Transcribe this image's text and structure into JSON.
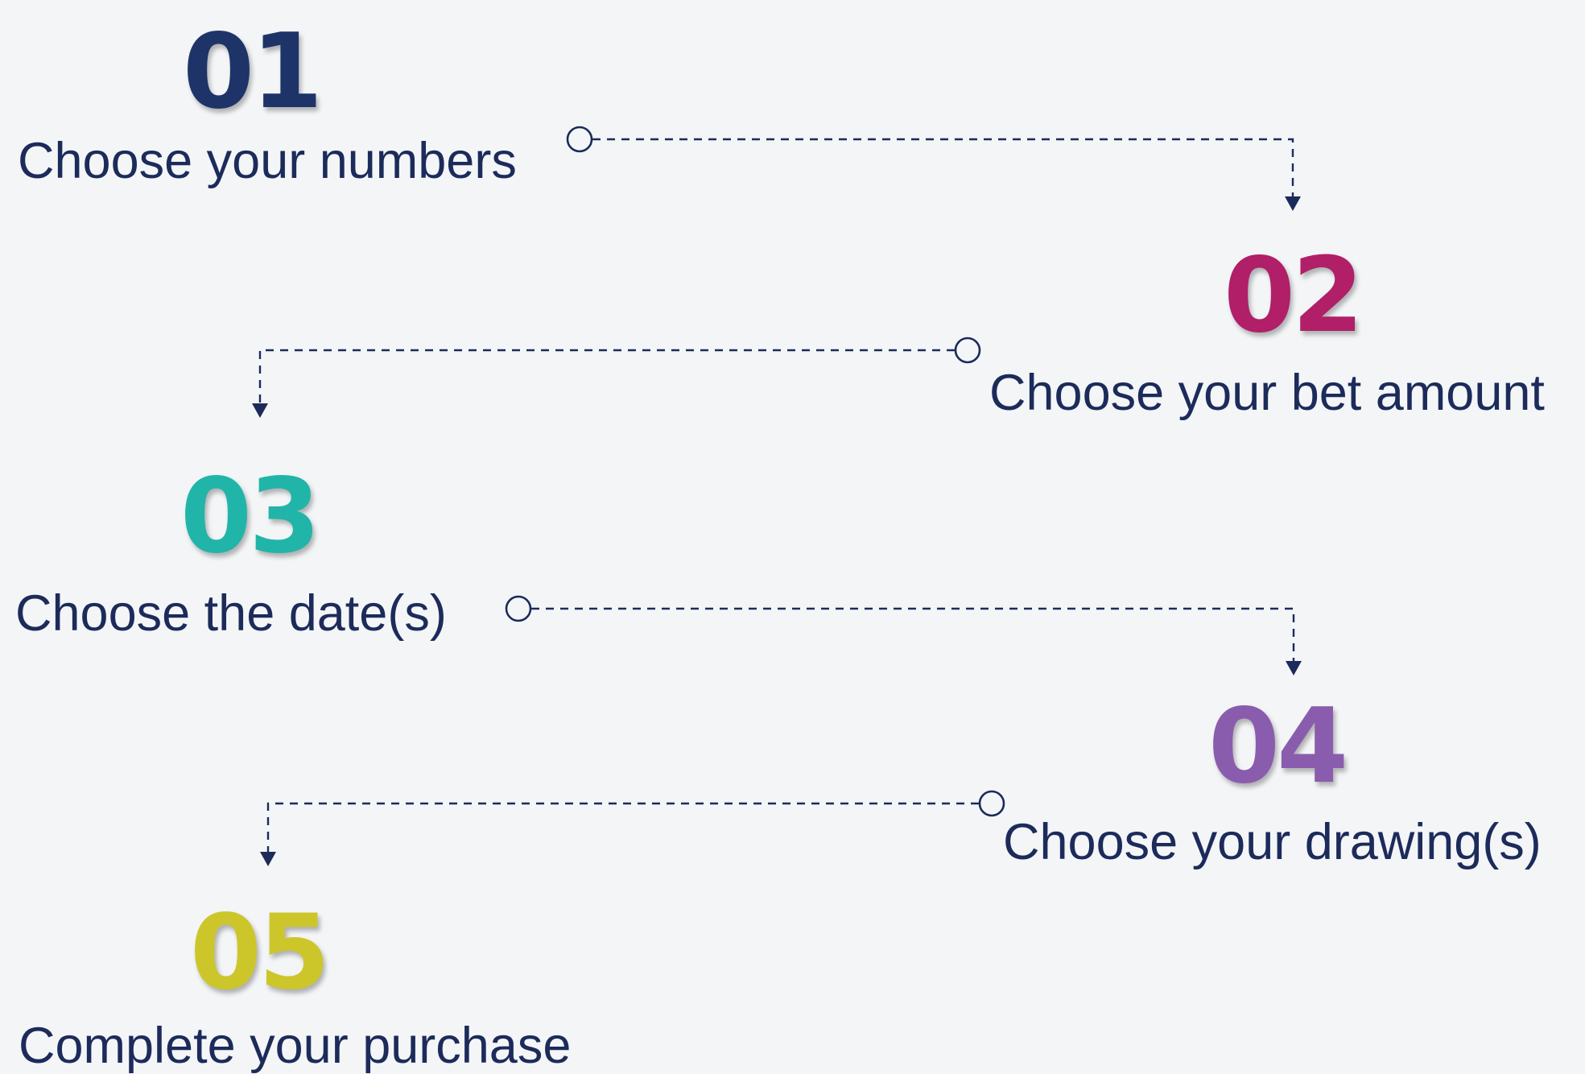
{
  "steps": [
    {
      "number": "01",
      "label": "Choose your numbers",
      "color": "#1e3468"
    },
    {
      "number": "02",
      "label": "Choose your bet amount",
      "color": "#b01f68"
    },
    {
      "number": "03",
      "label": "Choose the date(s)",
      "color": "#20b5a8"
    },
    {
      "number": "04",
      "label": "Choose your drawing(s)",
      "color": "#8a5cad"
    },
    {
      "number": "05",
      "label": "Complete your purchase",
      "color": "#cdc62a"
    }
  ],
  "connector_color": "#1c2b5a"
}
